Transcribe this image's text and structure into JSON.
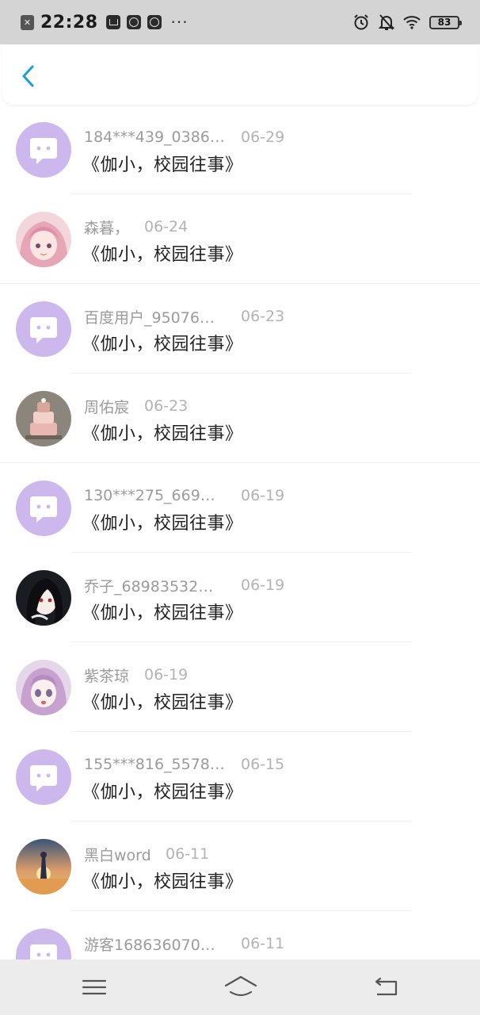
{
  "status_bar": {
    "time": "22:28",
    "battery": "83",
    "left_icons": [
      "close-box-icon",
      "mail-icon",
      "qq-icon",
      "qq-icon",
      "more-dots-icon"
    ],
    "right_icons": [
      "alarm-icon",
      "mute-bell-icon",
      "wifi-icon",
      "battery-icon"
    ],
    "more": "···"
  },
  "header": {
    "back_icon": "chevron-left-icon",
    "accent_color": "#1e9be6"
  },
  "messages": [
    {
      "user": "184***439_0386…",
      "date": "06-29",
      "text": "《伽小，校园往事》",
      "avatar": "default-chat-avatar"
    },
    {
      "user": "森暮，",
      "date": "06-24",
      "text": "《伽小，校园往事》",
      "avatar": "anime-pink-hair-avatar"
    },
    {
      "user": "百度用户_95076…",
      "date": "06-23",
      "text": "《伽小，校园往事》",
      "avatar": "default-chat-avatar"
    },
    {
      "user": "周佑宸",
      "date": "06-23",
      "text": "《伽小，校园往事》",
      "avatar": "cake-photo-avatar"
    },
    {
      "user": "130***275_669…",
      "date": "06-19",
      "text": "《伽小，校园往事》",
      "avatar": "default-chat-avatar"
    },
    {
      "user": "乔子_68983532…",
      "date": "06-19",
      "text": "《伽小，校园往事》",
      "avatar": "anime-dark-hair-avatar"
    },
    {
      "user": "紫茶琼",
      "date": "06-19",
      "text": "《伽小，校园往事》",
      "avatar": "anime-purple-hair-avatar"
    },
    {
      "user": "155***816_5578…",
      "date": "06-15",
      "text": "《伽小，校园往事》",
      "avatar": "default-chat-avatar"
    },
    {
      "user": "黑白word",
      "date": "06-11",
      "text": "《伽小，校园往事》",
      "avatar": "sunset-girl-avatar"
    },
    {
      "user": "游客168636070…",
      "date": "06-11",
      "text": "",
      "avatar": "default-chat-avatar"
    }
  ],
  "navbar": {
    "items": [
      "menu-icon",
      "home-icon",
      "back-icon"
    ]
  },
  "colors": {
    "default_avatar": "#cdb8ee",
    "status_bar_bg": "#d4d4d4",
    "navbar_bg": "#ececec"
  }
}
